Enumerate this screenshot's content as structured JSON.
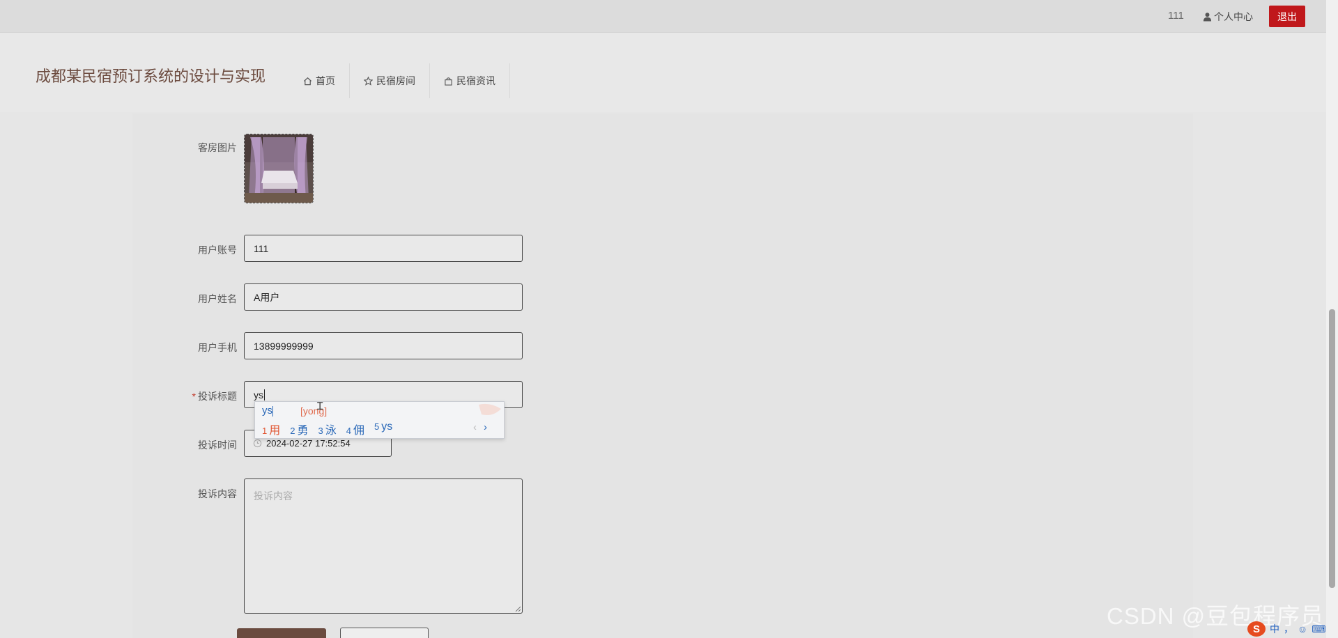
{
  "topbar": {
    "username": "111",
    "profile_label": "个人中心",
    "logout_label": "退出"
  },
  "header": {
    "title": "成都某民宿预订系统的设计与实现",
    "nav": [
      {
        "label": "首页",
        "icon": "home-icon"
      },
      {
        "label": "民宿房间",
        "icon": "star-icon"
      },
      {
        "label": "民宿资讯",
        "icon": "bag-icon"
      }
    ]
  },
  "form": {
    "image_label": "客房图片",
    "account_label": "用户账号",
    "account_value": "111",
    "name_label": "用户姓名",
    "name_value": "A用户",
    "phone_label": "用户手机",
    "phone_value": "13899999999",
    "title_label": "投诉标题",
    "title_required": "*",
    "title_value": "ys",
    "time_label": "投诉时间",
    "time_value": "2024-02-27 17:52:54",
    "content_label": "投诉内容",
    "content_placeholder": "投诉内容"
  },
  "ime": {
    "composition": "ys",
    "pinyin": "[yong]",
    "candidates": [
      {
        "num": "1",
        "text": "用"
      },
      {
        "num": "2",
        "text": "勇"
      },
      {
        "num": "3",
        "text": "泳"
      },
      {
        "num": "4",
        "text": "佣"
      },
      {
        "num": "5",
        "text": "ys"
      }
    ]
  },
  "watermark": "CSDN @豆包程序员",
  "tray": {
    "mode": "中",
    "punct": "，"
  },
  "colors": {
    "accent": "#c0181b",
    "brand": "#6b4a3e",
    "button": "#6a4b3f"
  }
}
